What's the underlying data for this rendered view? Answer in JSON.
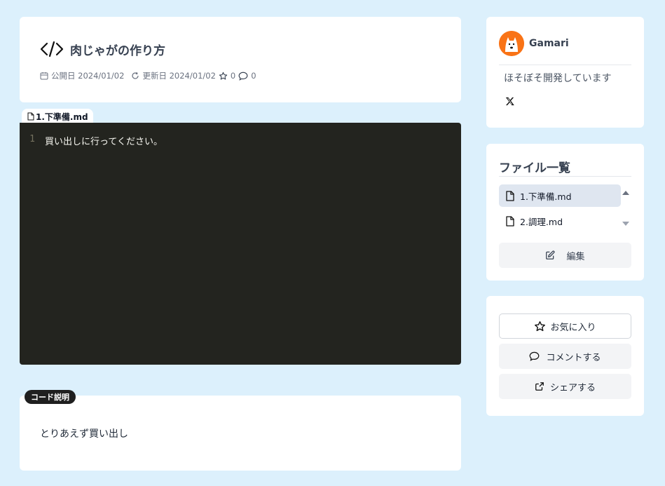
{
  "post": {
    "title": "肉じゃがの作り方",
    "published_label": "公開日",
    "published_date": "2024/01/02",
    "updated_label": "更新日",
    "updated_date": "2024/01/02",
    "stars": "0",
    "comments": "0"
  },
  "editor": {
    "tab_label": "1.下準備.md",
    "lines": [
      {
        "number": "1",
        "text": "買い出しに行ってください。"
      }
    ],
    "background": "#23241f"
  },
  "description": {
    "badge": "コード説明",
    "text": "とりあえず買い出し"
  },
  "profile": {
    "username": "Gamari",
    "bio": "ほそぼそ開発しています",
    "social_icon": "x-icon"
  },
  "files": {
    "heading": "ファイル一覧",
    "items": [
      {
        "label": "1.下準備.md",
        "active": true
      },
      {
        "label": "2.調理.md",
        "active": false
      }
    ],
    "edit_label": "編集"
  },
  "actions": {
    "favorite_label": "お気に入り",
    "comment_label": "コメントする",
    "share_label": "シェアする"
  },
  "colors": {
    "page_background": "#dcf0fc",
    "card": "#ffffff",
    "avatar": "#f97316"
  }
}
